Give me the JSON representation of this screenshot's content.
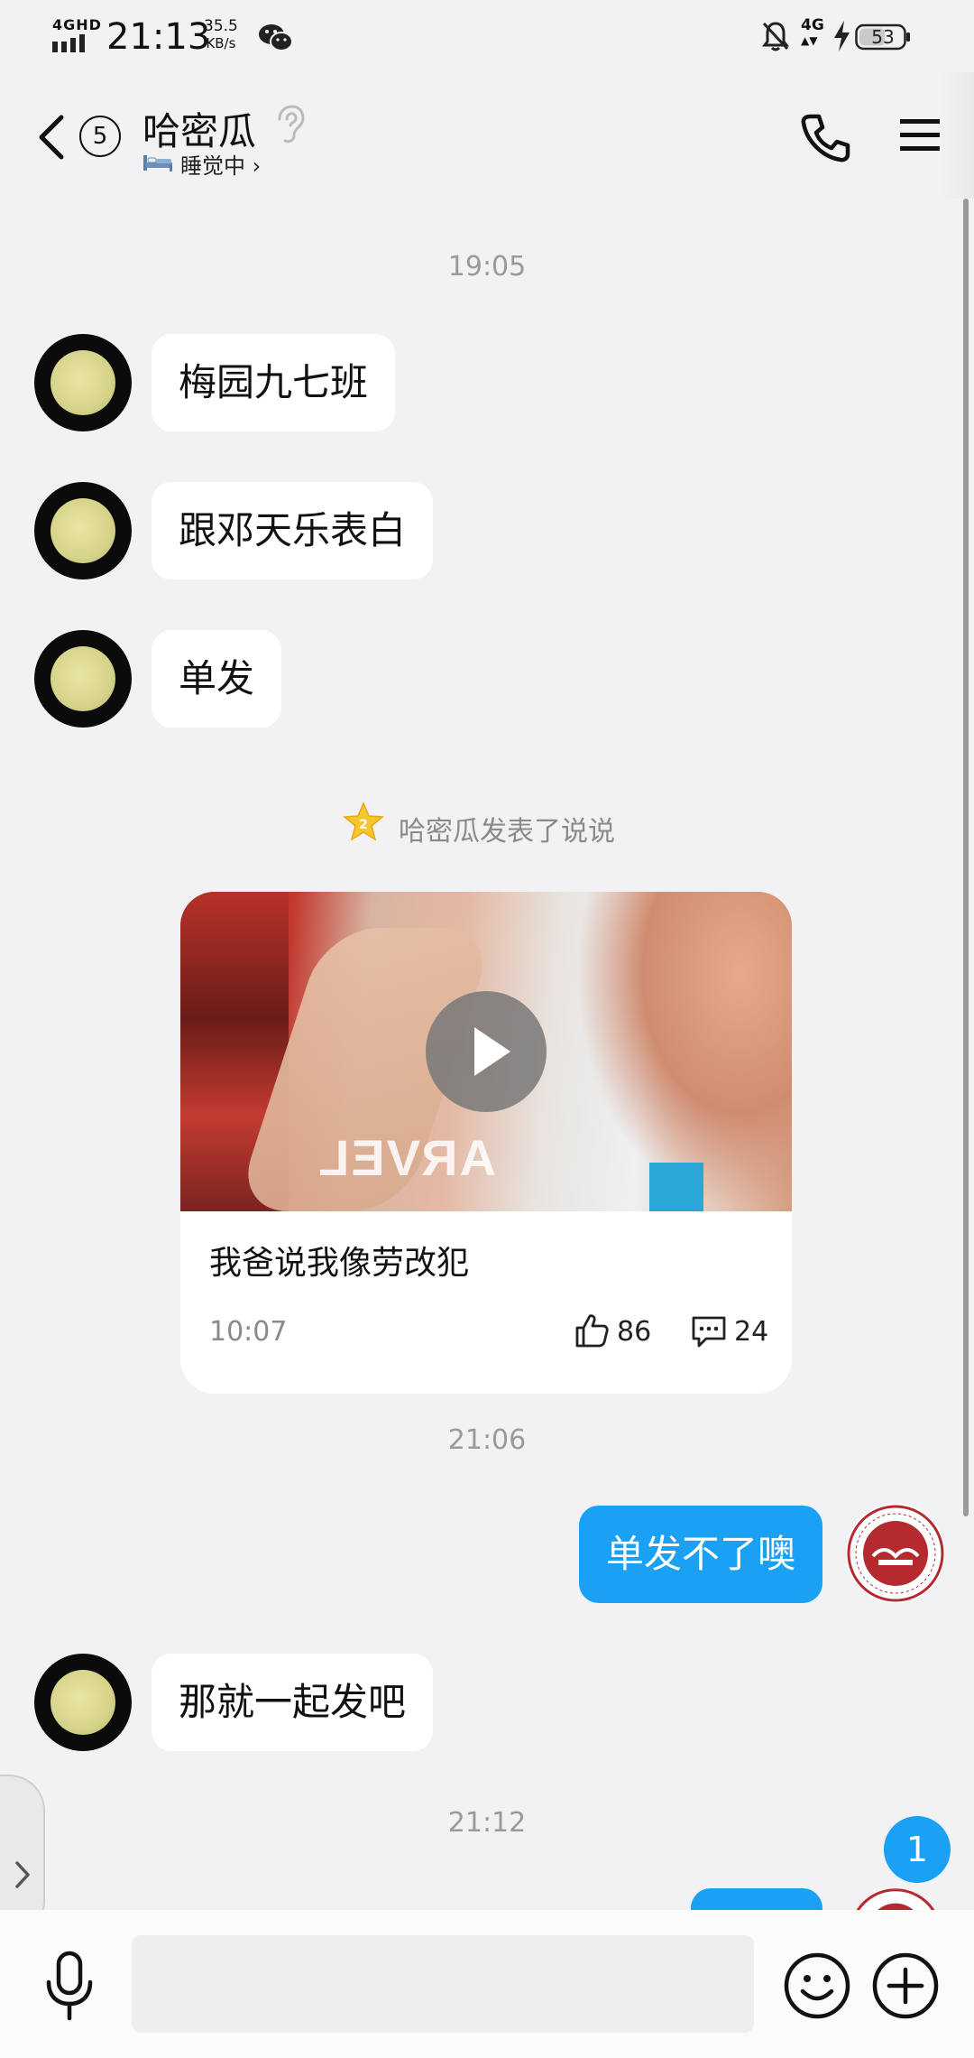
{
  "status_bar": {
    "network": "4GHD",
    "time": "21:13",
    "speed_value": "35.5",
    "speed_unit": "KB/s",
    "network_right": "4G",
    "battery": "53"
  },
  "header": {
    "back_count": "5",
    "title": "哈密瓜",
    "status": "睡觉中",
    "status_arrow": "›"
  },
  "chat": {
    "timestamps": [
      "19:05",
      "21:06",
      "21:12"
    ],
    "messages_in_1": [
      "梅园九七班",
      "跟邓天乐表白",
      "单发"
    ],
    "notice": "哈密瓜发表了说说",
    "post": {
      "text": "我爸说我像劳改犯",
      "time": "10:07",
      "likes": "86",
      "comments": "24",
      "video_overlay_text": "ARVEL"
    },
    "message_out_1": "单发不了噢",
    "message_in_2": "那就一起发吧",
    "badge_count": "1"
  },
  "colors": {
    "accent": "#1aa1f5",
    "background": "#f2f2f4",
    "bubble_in": "#ffffff"
  },
  "icons": [
    "back-icon",
    "ear-icon",
    "bed-icon",
    "phone-icon",
    "menu-icon",
    "star-icon",
    "play-icon",
    "thumbs-up-icon",
    "comment-icon",
    "microphone-icon",
    "emoji-icon",
    "plus-icon",
    "chevron-right-icon"
  ]
}
